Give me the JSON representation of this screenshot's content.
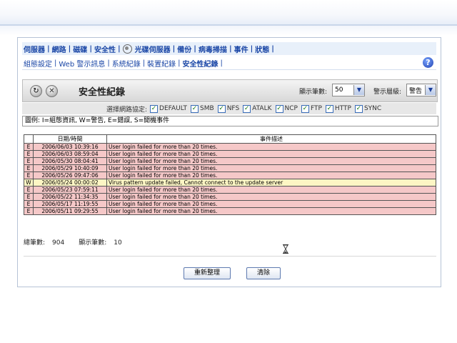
{
  "nav_main": [
    "伺服器",
    "網路",
    "磁碟",
    "安全性",
    "光碟伺服器",
    "備份",
    "病毒掃描",
    "事件",
    "狀態"
  ],
  "nav_sub": [
    "組態設定",
    "Web 警示訊息",
    "系統紀錄",
    "裝置紀錄",
    "安全性紀錄"
  ],
  "nav_sub_active": "安全性紀錄",
  "help_label": "?",
  "toolbar": {
    "title": "安全性紀錄",
    "page_size_label": "顯示筆數:",
    "page_size_value": "50",
    "level_label": "警示層級:",
    "level_value": "警告"
  },
  "protocol_filter": {
    "label": "選擇網路協定:",
    "options": [
      {
        "label": "DEFAULT",
        "checked": true
      },
      {
        "label": "SMB",
        "checked": true
      },
      {
        "label": "NFS",
        "checked": true
      },
      {
        "label": "ATALK",
        "checked": true
      },
      {
        "label": "NCP",
        "checked": true
      },
      {
        "label": "FTP",
        "checked": true
      },
      {
        "label": "HTTP",
        "checked": true
      },
      {
        "label": "SYNC",
        "checked": true
      }
    ]
  },
  "legend": "圖例: I=組態資訊, W=警告, E=錯誤, S=開機事件",
  "table": {
    "columns": [
      "",
      "日期/時間",
      "事件描述"
    ],
    "rows": [
      {
        "type": "E",
        "datetime": "2006/06/03 10:39:16",
        "desc": "User login failed for more than 20 times."
      },
      {
        "type": "E",
        "datetime": "2006/06/03 08:59:04",
        "desc": "User login failed for more than 20 times."
      },
      {
        "type": "E",
        "datetime": "2006/05/30 08:04:41",
        "desc": "User login failed for more than 20 times."
      },
      {
        "type": "E",
        "datetime": "2006/05/29 10:40:09",
        "desc": "User login failed for more than 20 times."
      },
      {
        "type": "E",
        "datetime": "2006/05/26 09:47:06",
        "desc": "User login failed for more than 20 times."
      },
      {
        "type": "W",
        "datetime": "2006/05/24 00:00:02",
        "desc": "Virus pattern update failed, Cannot connect to the update server"
      },
      {
        "type": "E",
        "datetime": "2006/05/23 07:59:11",
        "desc": "User login failed for more than 20 times."
      },
      {
        "type": "E",
        "datetime": "2006/05/22 11:34:35",
        "desc": "User login failed for more than 20 times."
      },
      {
        "type": "E",
        "datetime": "2006/05/17 11:19:55",
        "desc": "User login failed for more than 20 times."
      },
      {
        "type": "E",
        "datetime": "2006/05/11 09:29:55",
        "desc": "User login failed for more than 20 times."
      }
    ]
  },
  "summary": {
    "total_label": "總筆數:",
    "total": "904",
    "shown_label": "顯示筆數:",
    "shown": "10"
  },
  "buttons": {
    "refresh": "重新整理",
    "clear": "清除"
  },
  "colors": {
    "nav_text": "#1a46a6",
    "row_error": "#f5c8c8",
    "row_warning": "#fdf6c4"
  }
}
